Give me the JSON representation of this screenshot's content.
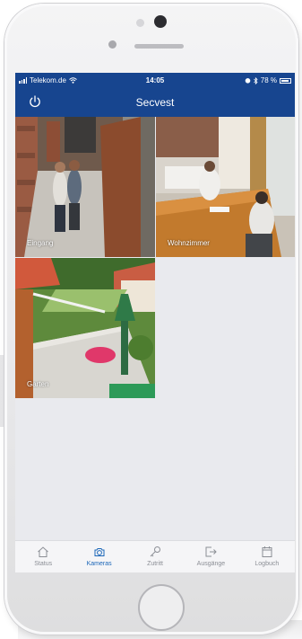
{
  "status_bar": {
    "carrier": "Telekom.de",
    "time": "14:05",
    "battery": "78 %"
  },
  "nav": {
    "title": "Secvest"
  },
  "cameras": [
    {
      "label": "Eingang"
    },
    {
      "label": "Wohnzimmer"
    },
    {
      "label": "Garten"
    }
  ],
  "tabs": [
    {
      "label": "Status",
      "icon": "home-icon",
      "active": false
    },
    {
      "label": "Kameras",
      "icon": "camera-icon",
      "active": true
    },
    {
      "label": "Zutritt",
      "icon": "key-icon",
      "active": false
    },
    {
      "label": "Ausgänge",
      "icon": "exit-icon",
      "active": false
    },
    {
      "label": "Logbuch",
      "icon": "calendar-icon",
      "active": false
    }
  ],
  "colors": {
    "header": "#17458f",
    "tab_active": "#1b66b8",
    "tab_inactive": "#8b8e95",
    "screen_background": "#e9eaee"
  }
}
